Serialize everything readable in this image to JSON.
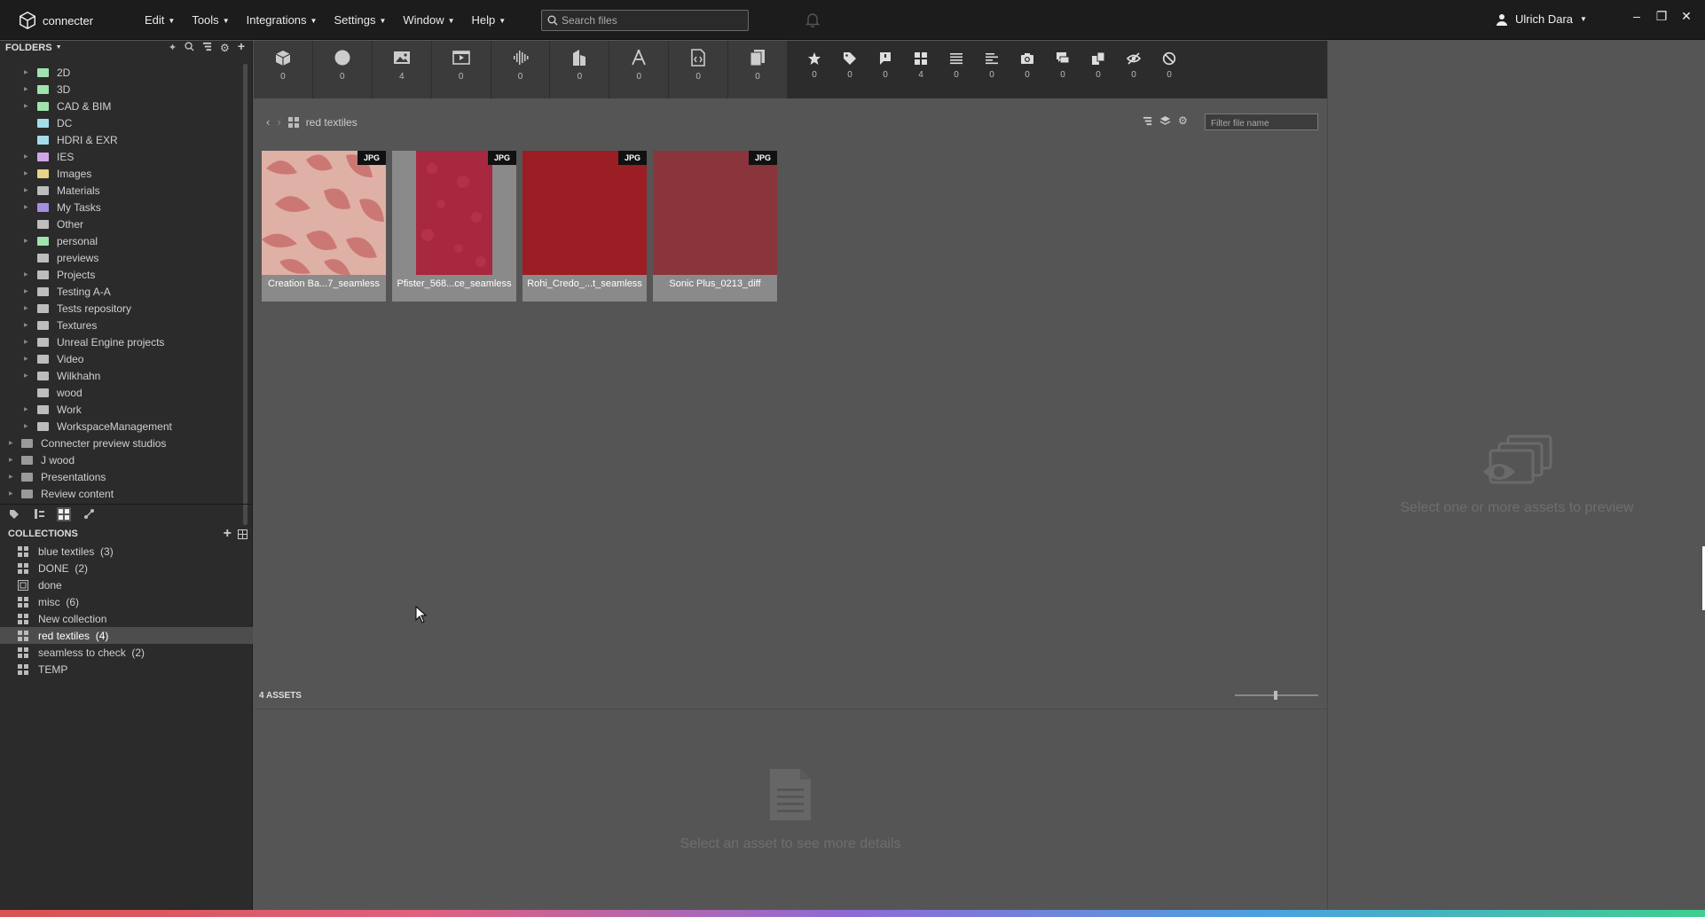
{
  "app": {
    "brand": "connecter"
  },
  "menu": [
    {
      "label": "Edit"
    },
    {
      "label": "Tools"
    },
    {
      "label": "Integrations"
    },
    {
      "label": "Settings"
    },
    {
      "label": "Window"
    },
    {
      "label": "Help"
    }
  ],
  "search": {
    "placeholder": "Search files"
  },
  "user": {
    "name": "Ulrich Dara"
  },
  "folders": {
    "title": "FOLDERS",
    "items": [
      {
        "label": "2D",
        "level": 2,
        "color": "#9fe3ae",
        "arrow": true
      },
      {
        "label": "3D",
        "level": 2,
        "color": "#9fe3ae",
        "arrow": true
      },
      {
        "label": "CAD & BIM",
        "level": 2,
        "color": "#9fe3ae",
        "arrow": true
      },
      {
        "label": "DC",
        "level": 2,
        "color": "#a4dde9",
        "arrow": false
      },
      {
        "label": "HDRI & EXR",
        "level": 2,
        "color": "#a4dde9",
        "arrow": false
      },
      {
        "label": "IES",
        "level": 2,
        "color": "#d0a6e8",
        "arrow": true
      },
      {
        "label": "Images",
        "level": 2,
        "color": "#e7d48a",
        "arrow": true
      },
      {
        "label": "Materials",
        "level": 2,
        "color": "#bdbdbd",
        "arrow": true
      },
      {
        "label": "My Tasks",
        "level": 2,
        "color": "#a58fe0",
        "arrow": true
      },
      {
        "label": "Other",
        "level": 2,
        "color": "#bdbdbd",
        "arrow": false
      },
      {
        "label": "personal",
        "level": 2,
        "color": "#9fe3ae",
        "arrow": true
      },
      {
        "label": "previews",
        "level": 2,
        "color": "#bdbdbd",
        "arrow": false
      },
      {
        "label": "Projects",
        "level": 2,
        "color": "#bdbdbd",
        "arrow": true
      },
      {
        "label": "Testing A-A",
        "level": 2,
        "color": "#bdbdbd",
        "arrow": true
      },
      {
        "label": "Tests repository",
        "level": 2,
        "color": "#bdbdbd",
        "arrow": true
      },
      {
        "label": "Textures",
        "level": 2,
        "color": "#bdbdbd",
        "arrow": true
      },
      {
        "label": "Unreal Engine projects",
        "level": 2,
        "color": "#bdbdbd",
        "arrow": true
      },
      {
        "label": "Video",
        "level": 2,
        "color": "#bdbdbd",
        "arrow": true
      },
      {
        "label": "Wilkhahn",
        "level": 2,
        "color": "#bdbdbd",
        "arrow": true
      },
      {
        "label": "wood",
        "level": 2,
        "color": "#bdbdbd",
        "arrow": false
      },
      {
        "label": "Work",
        "level": 2,
        "color": "#bdbdbd",
        "arrow": true
      },
      {
        "label": "WorkspaceManagement",
        "level": 2,
        "color": "#bdbdbd",
        "arrow": true
      },
      {
        "label": "Connecter preview studios",
        "level": 1,
        "color": "#9a9a9a",
        "arrow": true
      },
      {
        "label": "J wood",
        "level": 1,
        "color": "#9a9a9a",
        "arrow": true
      },
      {
        "label": "Presentations",
        "level": 1,
        "color": "#9a9a9a",
        "arrow": true
      },
      {
        "label": "Review content",
        "level": 1,
        "color": "#9a9a9a",
        "arrow": true
      }
    ]
  },
  "collections": {
    "title": "COLLECTIONS",
    "items": [
      {
        "label": "blue textiles  (3)",
        "selected": false,
        "icon": "grid"
      },
      {
        "label": "DONE  (2)",
        "selected": false,
        "icon": "grid"
      },
      {
        "label": "done",
        "selected": false,
        "icon": "smart"
      },
      {
        "label": "misc  (6)",
        "selected": false,
        "icon": "grid"
      },
      {
        "label": "New collection",
        "selected": false,
        "icon": "grid"
      },
      {
        "label": "red textiles  (4)",
        "selected": true,
        "icon": "grid"
      },
      {
        "label": "seamless to check  (2)",
        "selected": false,
        "icon": "grid"
      },
      {
        "label": "TEMP",
        "selected": false,
        "icon": "grid"
      }
    ]
  },
  "type_filters": [
    {
      "icon": "model-3d-icon",
      "count": "0"
    },
    {
      "icon": "material-sphere-icon",
      "count": "0"
    },
    {
      "icon": "image-icon",
      "count": "4"
    },
    {
      "icon": "video-icon",
      "count": "0"
    },
    {
      "icon": "audio-icon",
      "count": "0"
    },
    {
      "icon": "architecture-icon",
      "count": "0"
    },
    {
      "icon": "vector-pen-icon",
      "count": "0"
    },
    {
      "icon": "code-file-icon",
      "count": "0"
    },
    {
      "icon": "documents-icon",
      "count": "0"
    }
  ],
  "meta_filters": [
    {
      "icon": "star-icon",
      "count": "0"
    },
    {
      "icon": "tag-icon",
      "count": "0"
    },
    {
      "icon": "comment-flag-icon",
      "count": "0"
    },
    {
      "icon": "collection-icon",
      "count": "4"
    },
    {
      "icon": "list-icon",
      "count": "0"
    },
    {
      "icon": "align-left-icon",
      "count": "0"
    },
    {
      "icon": "camera-icon",
      "count": "0"
    },
    {
      "icon": "chat-icon",
      "count": "0"
    },
    {
      "icon": "duplicate-icon",
      "count": "0"
    },
    {
      "icon": "hidden-icon",
      "count": "0"
    },
    {
      "icon": "blocked-icon",
      "count": "0"
    }
  ],
  "breadcrumb": {
    "current": "red textiles"
  },
  "filter": {
    "placeholder": "Filter file name"
  },
  "assets": [
    {
      "name": "Creation Ba...7_seamless",
      "type": "JPG"
    },
    {
      "name": "Pfister_568...ce_seamless",
      "type": "JPG"
    },
    {
      "name": "Rohi_Credo_...t_seamless",
      "type": "JPG"
    },
    {
      "name": "Sonic Plus_0213_diff",
      "type": "JPG"
    }
  ],
  "assets_count": "4 ASSETS",
  "details_msg": "Select an asset to see more details",
  "preview_msg": "Select one or more assets to preview"
}
